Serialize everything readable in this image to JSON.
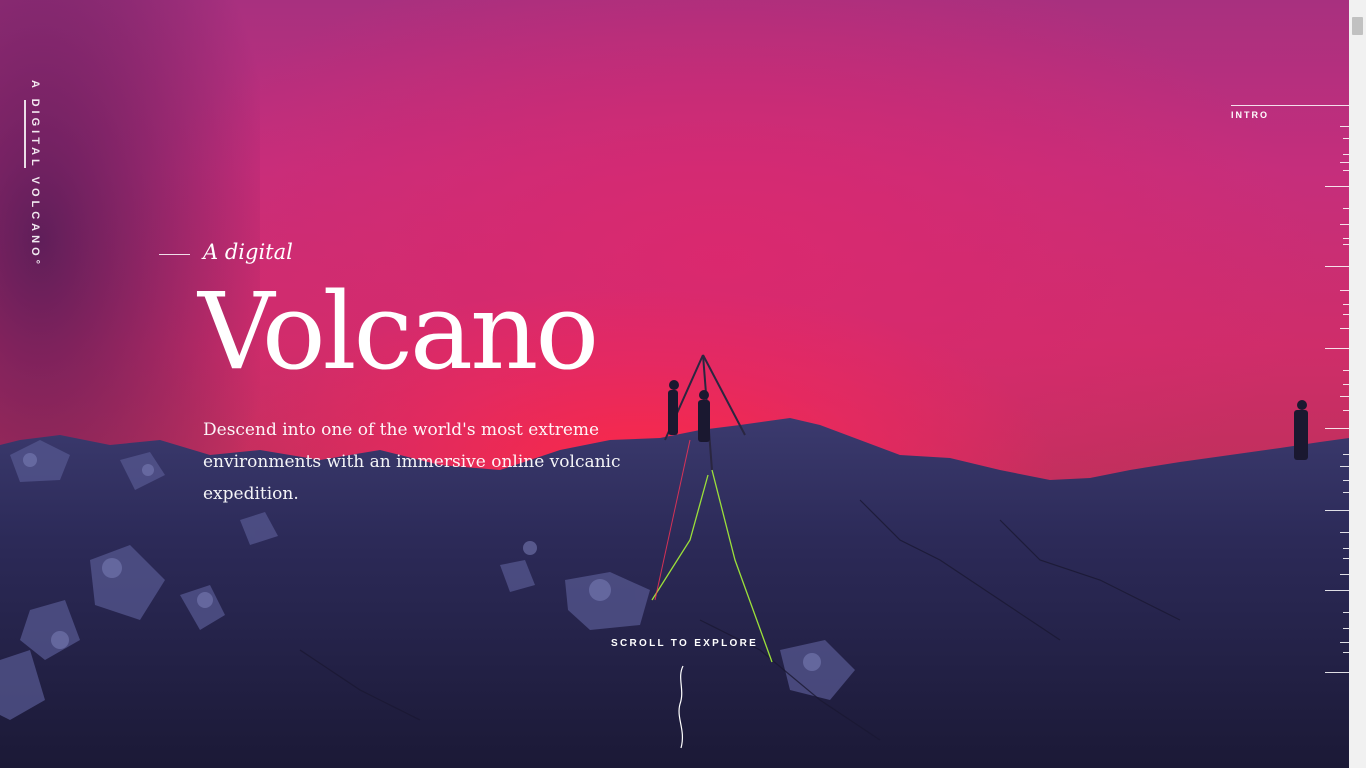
{
  "brand": {
    "vertical_text": "A DIGITAL VOLCANO°"
  },
  "hero": {
    "kicker": "A digital",
    "title": "Volcano",
    "description": "Descend into one of the world's most extreme environments with an immersive online volcanic expedition.",
    "scroll_cta": "SCROLL TO EXPLORE"
  },
  "nav": {
    "section_label": "INTRO"
  },
  "colors": {
    "sky_top": "#a8307f",
    "lava_glow": "#ff2846",
    "rock": "#2a2650"
  }
}
